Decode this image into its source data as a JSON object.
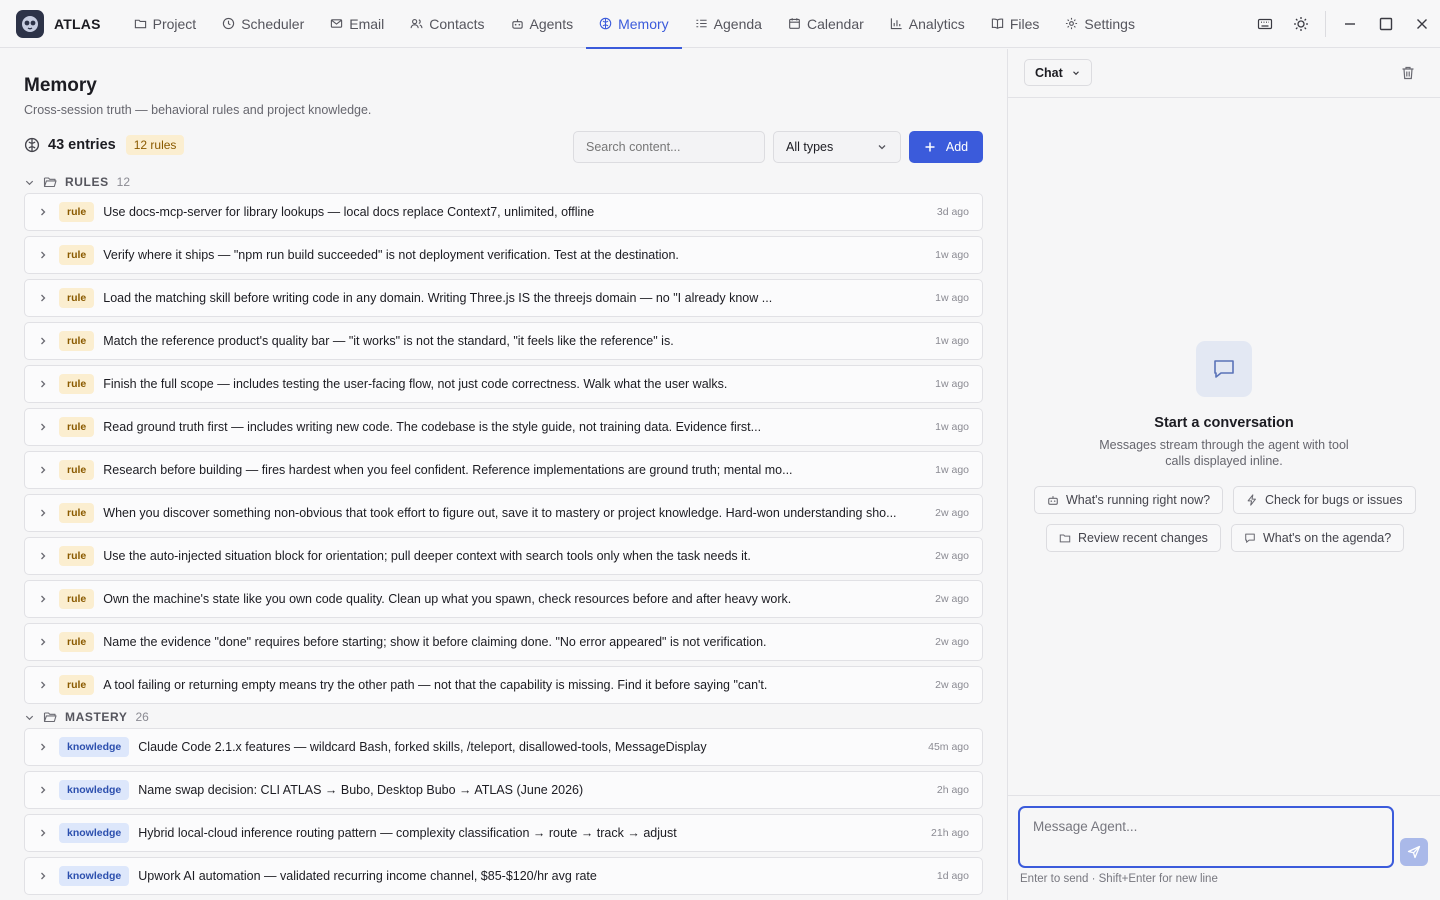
{
  "app": {
    "name": "ATLAS"
  },
  "nav": [
    {
      "label": "Project",
      "icon": "folder-icon"
    },
    {
      "label": "Scheduler",
      "icon": "clock-icon"
    },
    {
      "label": "Email",
      "icon": "mail-icon"
    },
    {
      "label": "Contacts",
      "icon": "users-icon"
    },
    {
      "label": "Agents",
      "icon": "robot-icon"
    },
    {
      "label": "Memory",
      "icon": "brain-icon",
      "active": true
    },
    {
      "label": "Agenda",
      "icon": "list-icon"
    },
    {
      "label": "Calendar",
      "icon": "calendar-icon"
    },
    {
      "label": "Analytics",
      "icon": "bar-chart-icon"
    },
    {
      "label": "Files",
      "icon": "book-icon"
    },
    {
      "label": "Settings",
      "icon": "gear-icon"
    }
  ],
  "page": {
    "title": "Memory",
    "subtitle": "Cross-session truth — behavioral rules and project knowledge.",
    "entries_label": "43 entries",
    "rules_badge": "12 rules",
    "search_placeholder": "Search content...",
    "type_filter": "All types",
    "add_label": "Add"
  },
  "groups": [
    {
      "name": "RULES",
      "count": "12",
      "items": [
        {
          "tag": "rule",
          "title": "Use docs-mcp-server for library lookups — local docs replace Context7, unlimited, offline",
          "when": "3d ago"
        },
        {
          "tag": "rule",
          "title": "Verify where it ships — \"npm run build succeeded\" is not deployment verification. Test at the destination.",
          "when": "1w ago"
        },
        {
          "tag": "rule",
          "title": "Load the matching skill before writing code in any domain. Writing Three.js IS the threejs domain — no \"I already know ...",
          "when": "1w ago"
        },
        {
          "tag": "rule",
          "title": "Match the reference product's quality bar — \"it works\" is not the standard, \"it feels like the reference\" is.",
          "when": "1w ago"
        },
        {
          "tag": "rule",
          "title": "Finish the full scope — includes testing the user-facing flow, not just code correctness. Walk what the user walks.",
          "when": "1w ago"
        },
        {
          "tag": "rule",
          "title": "Read ground truth first — includes writing new code. The codebase is the style guide, not training data. Evidence first...",
          "when": "1w ago"
        },
        {
          "tag": "rule",
          "title": "Research before building — fires hardest when you feel confident. Reference implementations are ground truth; mental mo...",
          "when": "1w ago"
        },
        {
          "tag": "rule",
          "title": "When you discover something non-obvious that took effort to figure out, save it to mastery or project knowledge. Hard-won understanding sho...",
          "when": "2w ago"
        },
        {
          "tag": "rule",
          "title": "Use the auto-injected situation block for orientation; pull deeper context with search tools only when the task needs it.",
          "when": "2w ago"
        },
        {
          "tag": "rule",
          "title": "Own the machine's state like you own code quality. Clean up what you spawn, check resources before and after heavy work.",
          "when": "2w ago"
        },
        {
          "tag": "rule",
          "title": "Name the evidence \"done\" requires before starting; show it before claiming done. \"No error appeared\" is not verification.",
          "when": "2w ago"
        },
        {
          "tag": "rule",
          "title": "A tool failing or returning empty means try the other path — not that the capability is missing. Find it before saying \"can't.",
          "when": "2w ago"
        }
      ]
    },
    {
      "name": "MASTERY",
      "count": "26",
      "items": [
        {
          "tag": "knowledge",
          "title": "Claude Code 2.1.x features — wildcard Bash, forked skills, /teleport, disallowed-tools, MessageDisplay",
          "when": "45m ago"
        },
        {
          "tag": "knowledge",
          "title": "Name swap decision: CLI ATLAS → Bubo, Desktop Bubo → ATLAS (June 2026)",
          "when": "2h ago"
        },
        {
          "tag": "knowledge",
          "title": "Hybrid local-cloud inference routing pattern — complexity classification → route → track → adjust",
          "when": "21h ago"
        },
        {
          "tag": "knowledge",
          "title": "Upwork AI automation — validated recurring income channel, $85-$120/hr avg rate",
          "when": "1d ago"
        }
      ]
    }
  ],
  "chat": {
    "mode": "Chat",
    "empty_title": "Start a conversation",
    "empty_sub": "Messages stream through the agent with tool calls displayed inline.",
    "suggestions": [
      {
        "label": "What's running right now?",
        "icon": "robot-icon"
      },
      {
        "label": "Check for bugs or issues",
        "icon": "zap-icon"
      },
      {
        "label": "Review recent changes",
        "icon": "folder-icon"
      },
      {
        "label": "What's on the agenda?",
        "icon": "chat-icon"
      }
    ],
    "input_placeholder": "Message Agent...",
    "hint": "Enter to send · Shift+Enter for new line"
  },
  "colors": {
    "accent": "#3b5bdb",
    "rule_tag_bg": "#fbeed0",
    "knowledge_tag_bg": "#dde7fb"
  }
}
